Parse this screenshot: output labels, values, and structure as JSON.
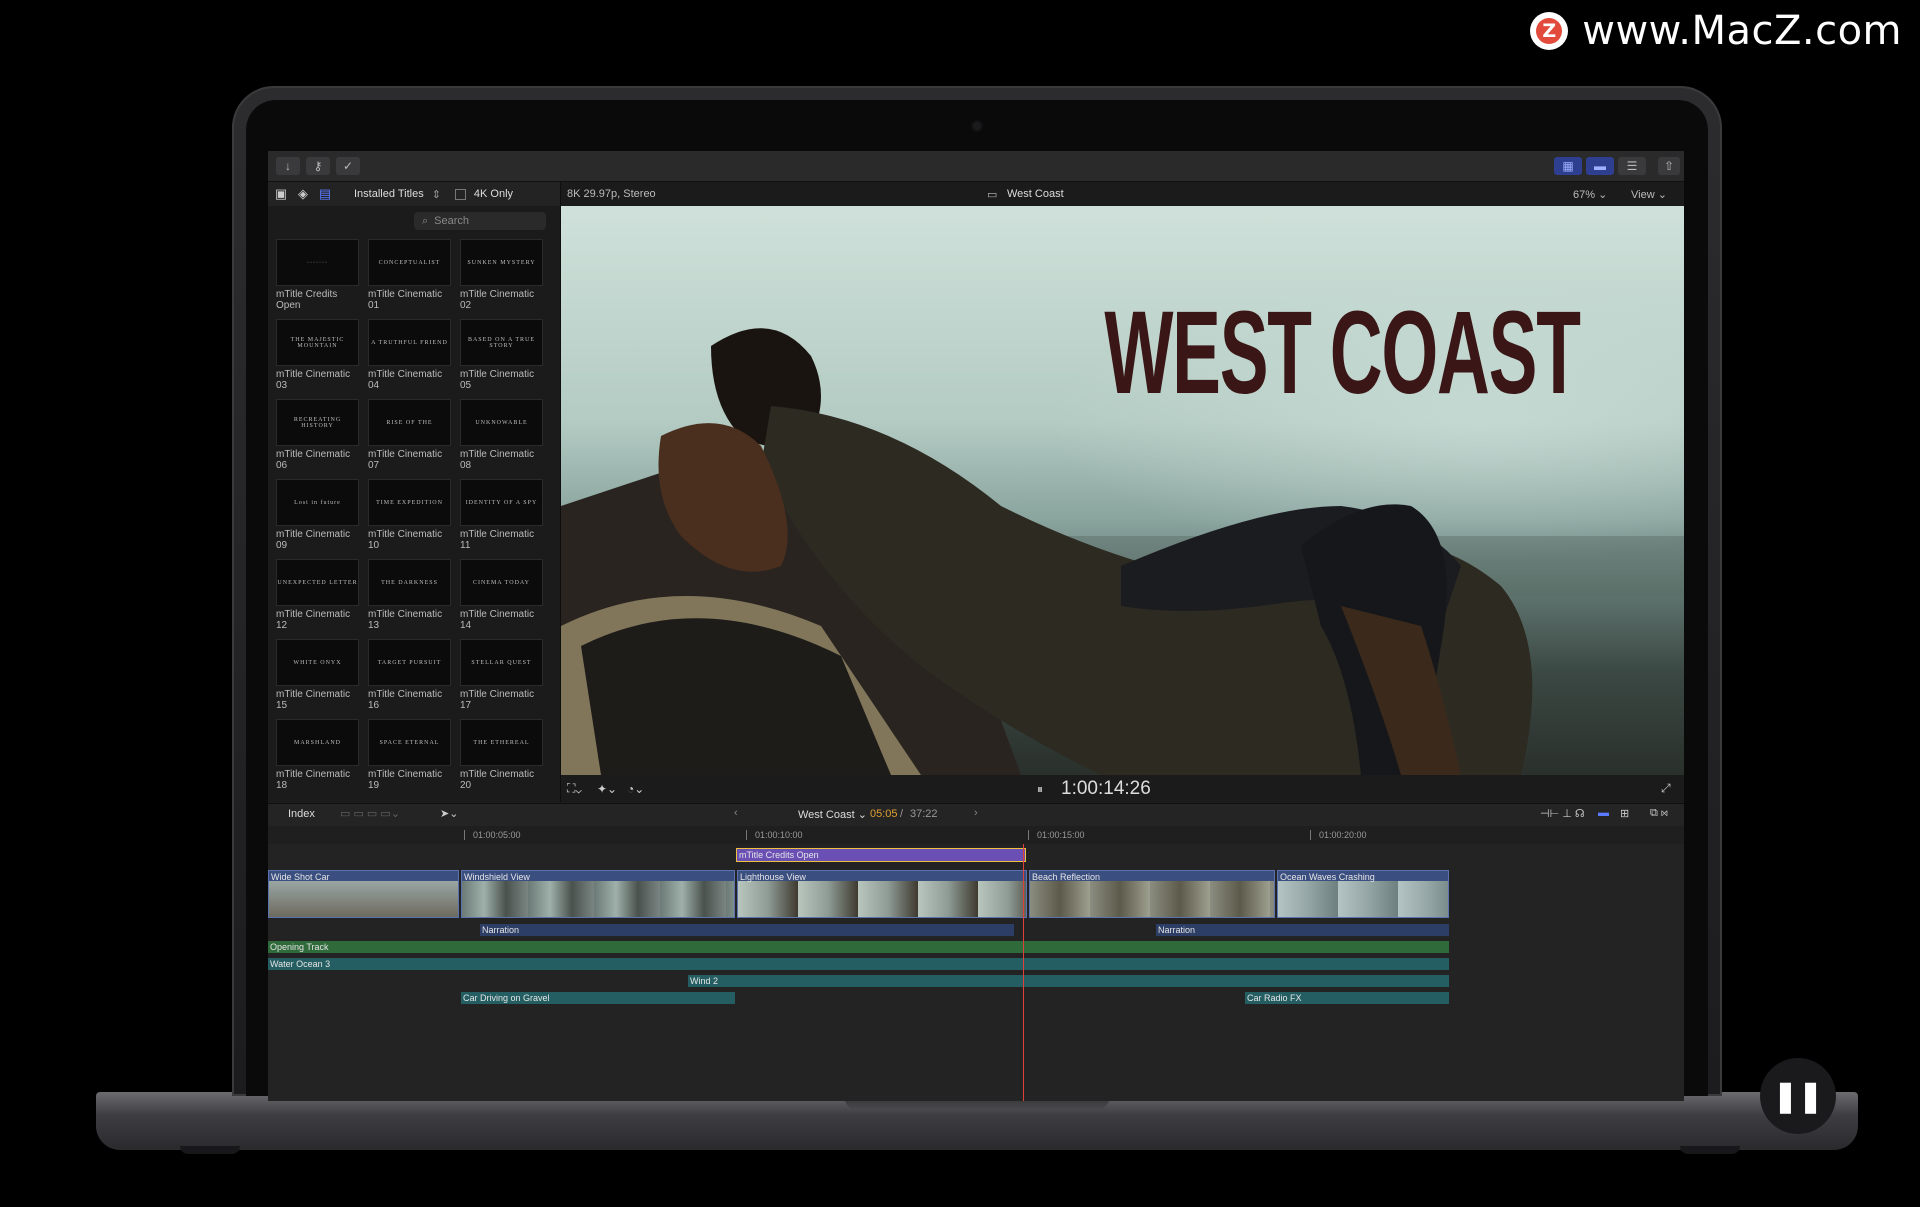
{
  "watermark": {
    "logo_letter": "Z",
    "text": "www.MacZ.com"
  },
  "toolbar": {
    "import_icon": "↓",
    "key_icon": "⚷",
    "check_icon": "✓"
  },
  "browser": {
    "source_label": "Installed Titles",
    "toggle_label": "4K Only",
    "search_placeholder": "Search",
    "titles": [
      {
        "name": "mTitle Credits Open",
        "art": "·······"
      },
      {
        "name": "mTitle Cinematic 01",
        "art": "CONCEPTUALIST"
      },
      {
        "name": "mTitle Cinematic 02",
        "art": "SUNKEN MYSTERY"
      },
      {
        "name": "mTitle Cinematic 03",
        "art": "THE MAJESTIC MOUNTAIN"
      },
      {
        "name": "mTitle Cinematic 04",
        "art": "A TRUTHFUL FRIEND"
      },
      {
        "name": "mTitle Cinematic 05",
        "art": "BASED ON A TRUE STORY"
      },
      {
        "name": "mTitle Cinematic 06",
        "art": "RECREATING HISTORY"
      },
      {
        "name": "mTitle Cinematic 07",
        "art": "RISE OF THE"
      },
      {
        "name": "mTitle Cinematic 08",
        "art": "UNKNOWABLE"
      },
      {
        "name": "mTitle Cinematic 09",
        "art": "Lost in future"
      },
      {
        "name": "mTitle Cinematic 10",
        "art": "TIME EXPEDITION"
      },
      {
        "name": "mTitle Cinematic 11",
        "art": "IDENTITY OF A SPY"
      },
      {
        "name": "mTitle Cinematic 12",
        "art": "UNEXPECTED LETTER"
      },
      {
        "name": "mTitle Cinematic 13",
        "art": "THE DARKNESS"
      },
      {
        "name": "mTitle Cinematic 14",
        "art": "CINEMA TODAY"
      },
      {
        "name": "mTitle Cinematic 15",
        "art": "WHITE ONYX"
      },
      {
        "name": "mTitle Cinematic 16",
        "art": "TARGET PURSUIT"
      },
      {
        "name": "mTitle Cinematic 17",
        "art": "STELLAR QUEST"
      },
      {
        "name": "mTitle Cinematic 18",
        "art": "MARSHLAND"
      },
      {
        "name": "mTitle Cinematic 19",
        "art": "SPACE ETERNAL"
      },
      {
        "name": "mTitle Cinematic 20",
        "art": "THE ETHEREAL"
      }
    ]
  },
  "viewer": {
    "format": "8K 29.97p, Stereo",
    "project": "West Coast",
    "zoom": "67%",
    "view_label": "View",
    "title_text": "WEST COAST",
    "timecode": "1:00:14:26"
  },
  "timeline_bar": {
    "index_label": "Index",
    "project": "West Coast",
    "duration": "05:05",
    "total": "37:22"
  },
  "timeline": {
    "ruler": [
      "01:00:05:00",
      "01:00:10:00",
      "01:00:15:00",
      "01:00:20:00"
    ],
    "title_clip": "mTitle Credits Open",
    "video_clips": [
      "Wide Shot Car",
      "Windshield View",
      "Lighthouse View",
      "Beach Reflection",
      "Ocean Waves Crashing"
    ],
    "audio_clips": {
      "narration_a": "Narration",
      "narration_b": "Narration",
      "opening": "Opening Track",
      "water": "Water Ocean 3",
      "wind": "Wind 2",
      "gravel": "Car Driving on Gravel",
      "radio": "Car Radio FX"
    }
  },
  "colors": {
    "accent": "#5a7aff",
    "playhead": "#e0403a",
    "title_clip": "#6a4fb5",
    "title_text": "#3a1616"
  }
}
